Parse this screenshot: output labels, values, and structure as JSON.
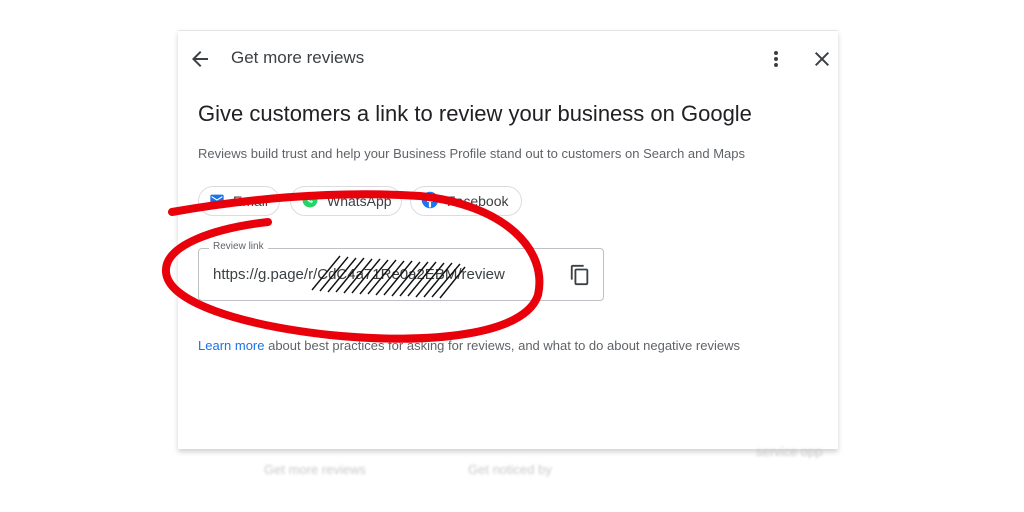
{
  "header": {
    "title": "Get more reviews",
    "back_icon": "arrow-back-icon",
    "more_icon": "more-vert-icon",
    "close_icon": "close-icon"
  },
  "headline": "Give customers a link to review your business on Google",
  "subtext": "Reviews build trust and help your Business Profile stand out to customers on Search and Maps",
  "share_chips": [
    {
      "label": "Email",
      "icon": "mail-icon"
    },
    {
      "label": "WhatsApp",
      "icon": "whatsapp-icon"
    },
    {
      "label": "Facebook",
      "icon": "facebook-icon"
    }
  ],
  "review_link": {
    "label": "Review link",
    "value": "https://g.page/r/CdC4a71Re0a2EBM/review",
    "copy_icon": "copy-icon"
  },
  "footnote": {
    "link_text": "Learn more",
    "text": " about best practices for asking for reviews, and what to do about negative reviews"
  },
  "background_strip": {
    "left_text": "Get more reviews",
    "middle_text": "Get noticed by",
    "right_text": "service opp"
  },
  "colors": {
    "accent": "#1a73e8",
    "annotation": "#e8000b",
    "facebook": "#1877f2",
    "whatsapp": "#25d366"
  }
}
